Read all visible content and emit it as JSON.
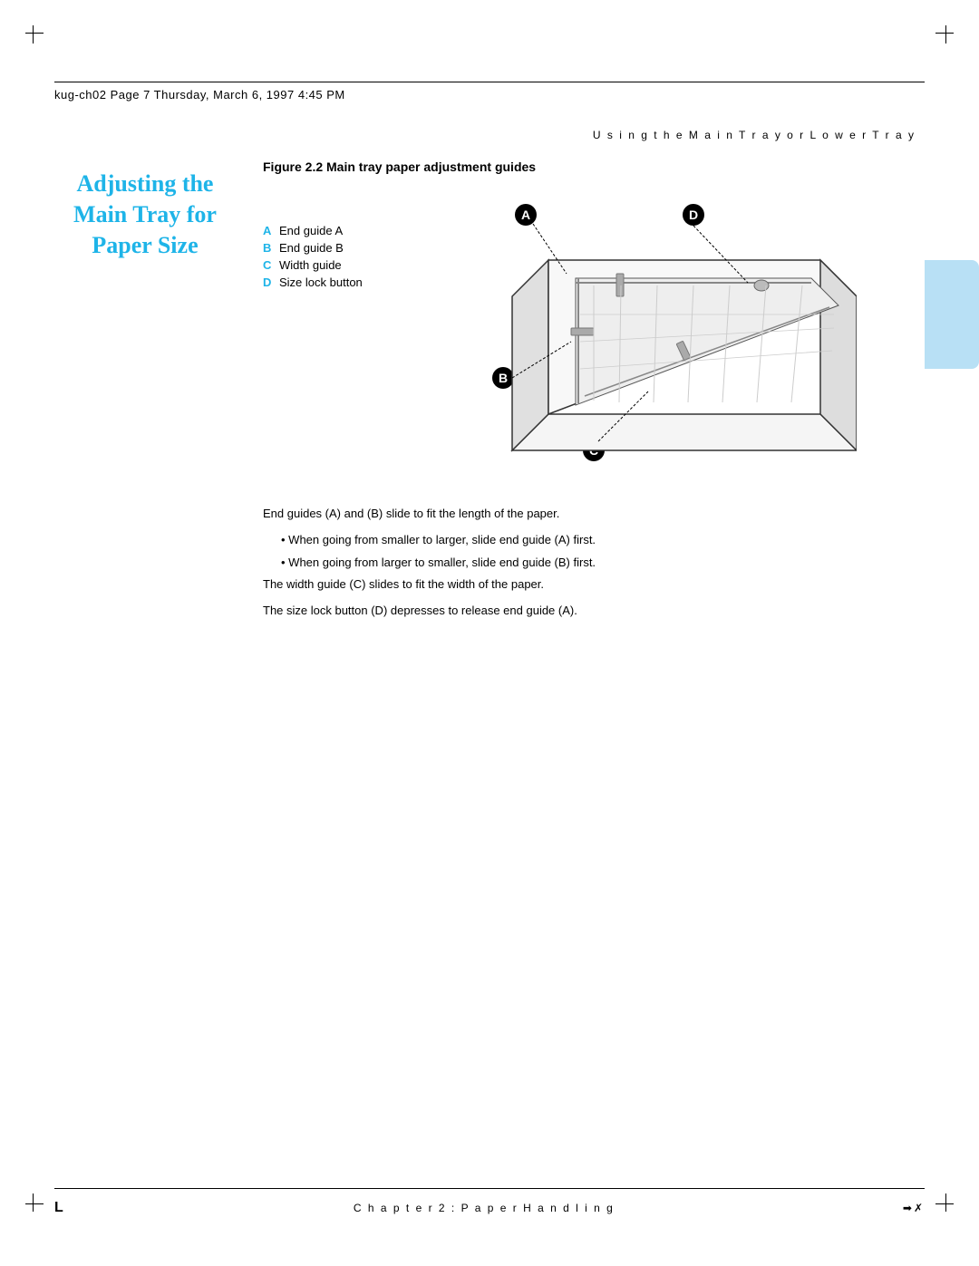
{
  "header": {
    "text": "kug-ch02  Page 7  Thursday, March 6, 1997  4:45 PM"
  },
  "running_header": "U s i n g   t h e   M a i n   T r a y   o r   L o w e r   T r a y",
  "title": {
    "line1": "Adjusting the",
    "line2": "Main Tray for",
    "line3": "Paper Size"
  },
  "figure": {
    "caption": "Figure 2.2   Main tray paper adjustment guides"
  },
  "legend": {
    "items": [
      {
        "letter": "A",
        "text": "End guide A"
      },
      {
        "letter": "B",
        "text": "End guide B"
      },
      {
        "letter": "C",
        "text": "Width guide"
      },
      {
        "letter": "D",
        "text": "Size lock button"
      }
    ]
  },
  "body": {
    "para1": "End guides (A) and (B) slide to fit the length of the paper.",
    "bullet1": "When going from smaller to larger, slide end guide (A) first.",
    "bullet2": "When going from larger to smaller, slide end guide (B) first.",
    "para2": "The width guide (C) slides to fit the width of the paper.",
    "para3": "The size lock button (D) depresses to release end guide (A)."
  },
  "footer": {
    "left": "L",
    "center": "C h a p t e r   2 :   P a p e r   H a n d l i n g",
    "right": "➡✗"
  },
  "callouts": {
    "A": "A",
    "B": "B",
    "C": "C",
    "D": "D"
  }
}
